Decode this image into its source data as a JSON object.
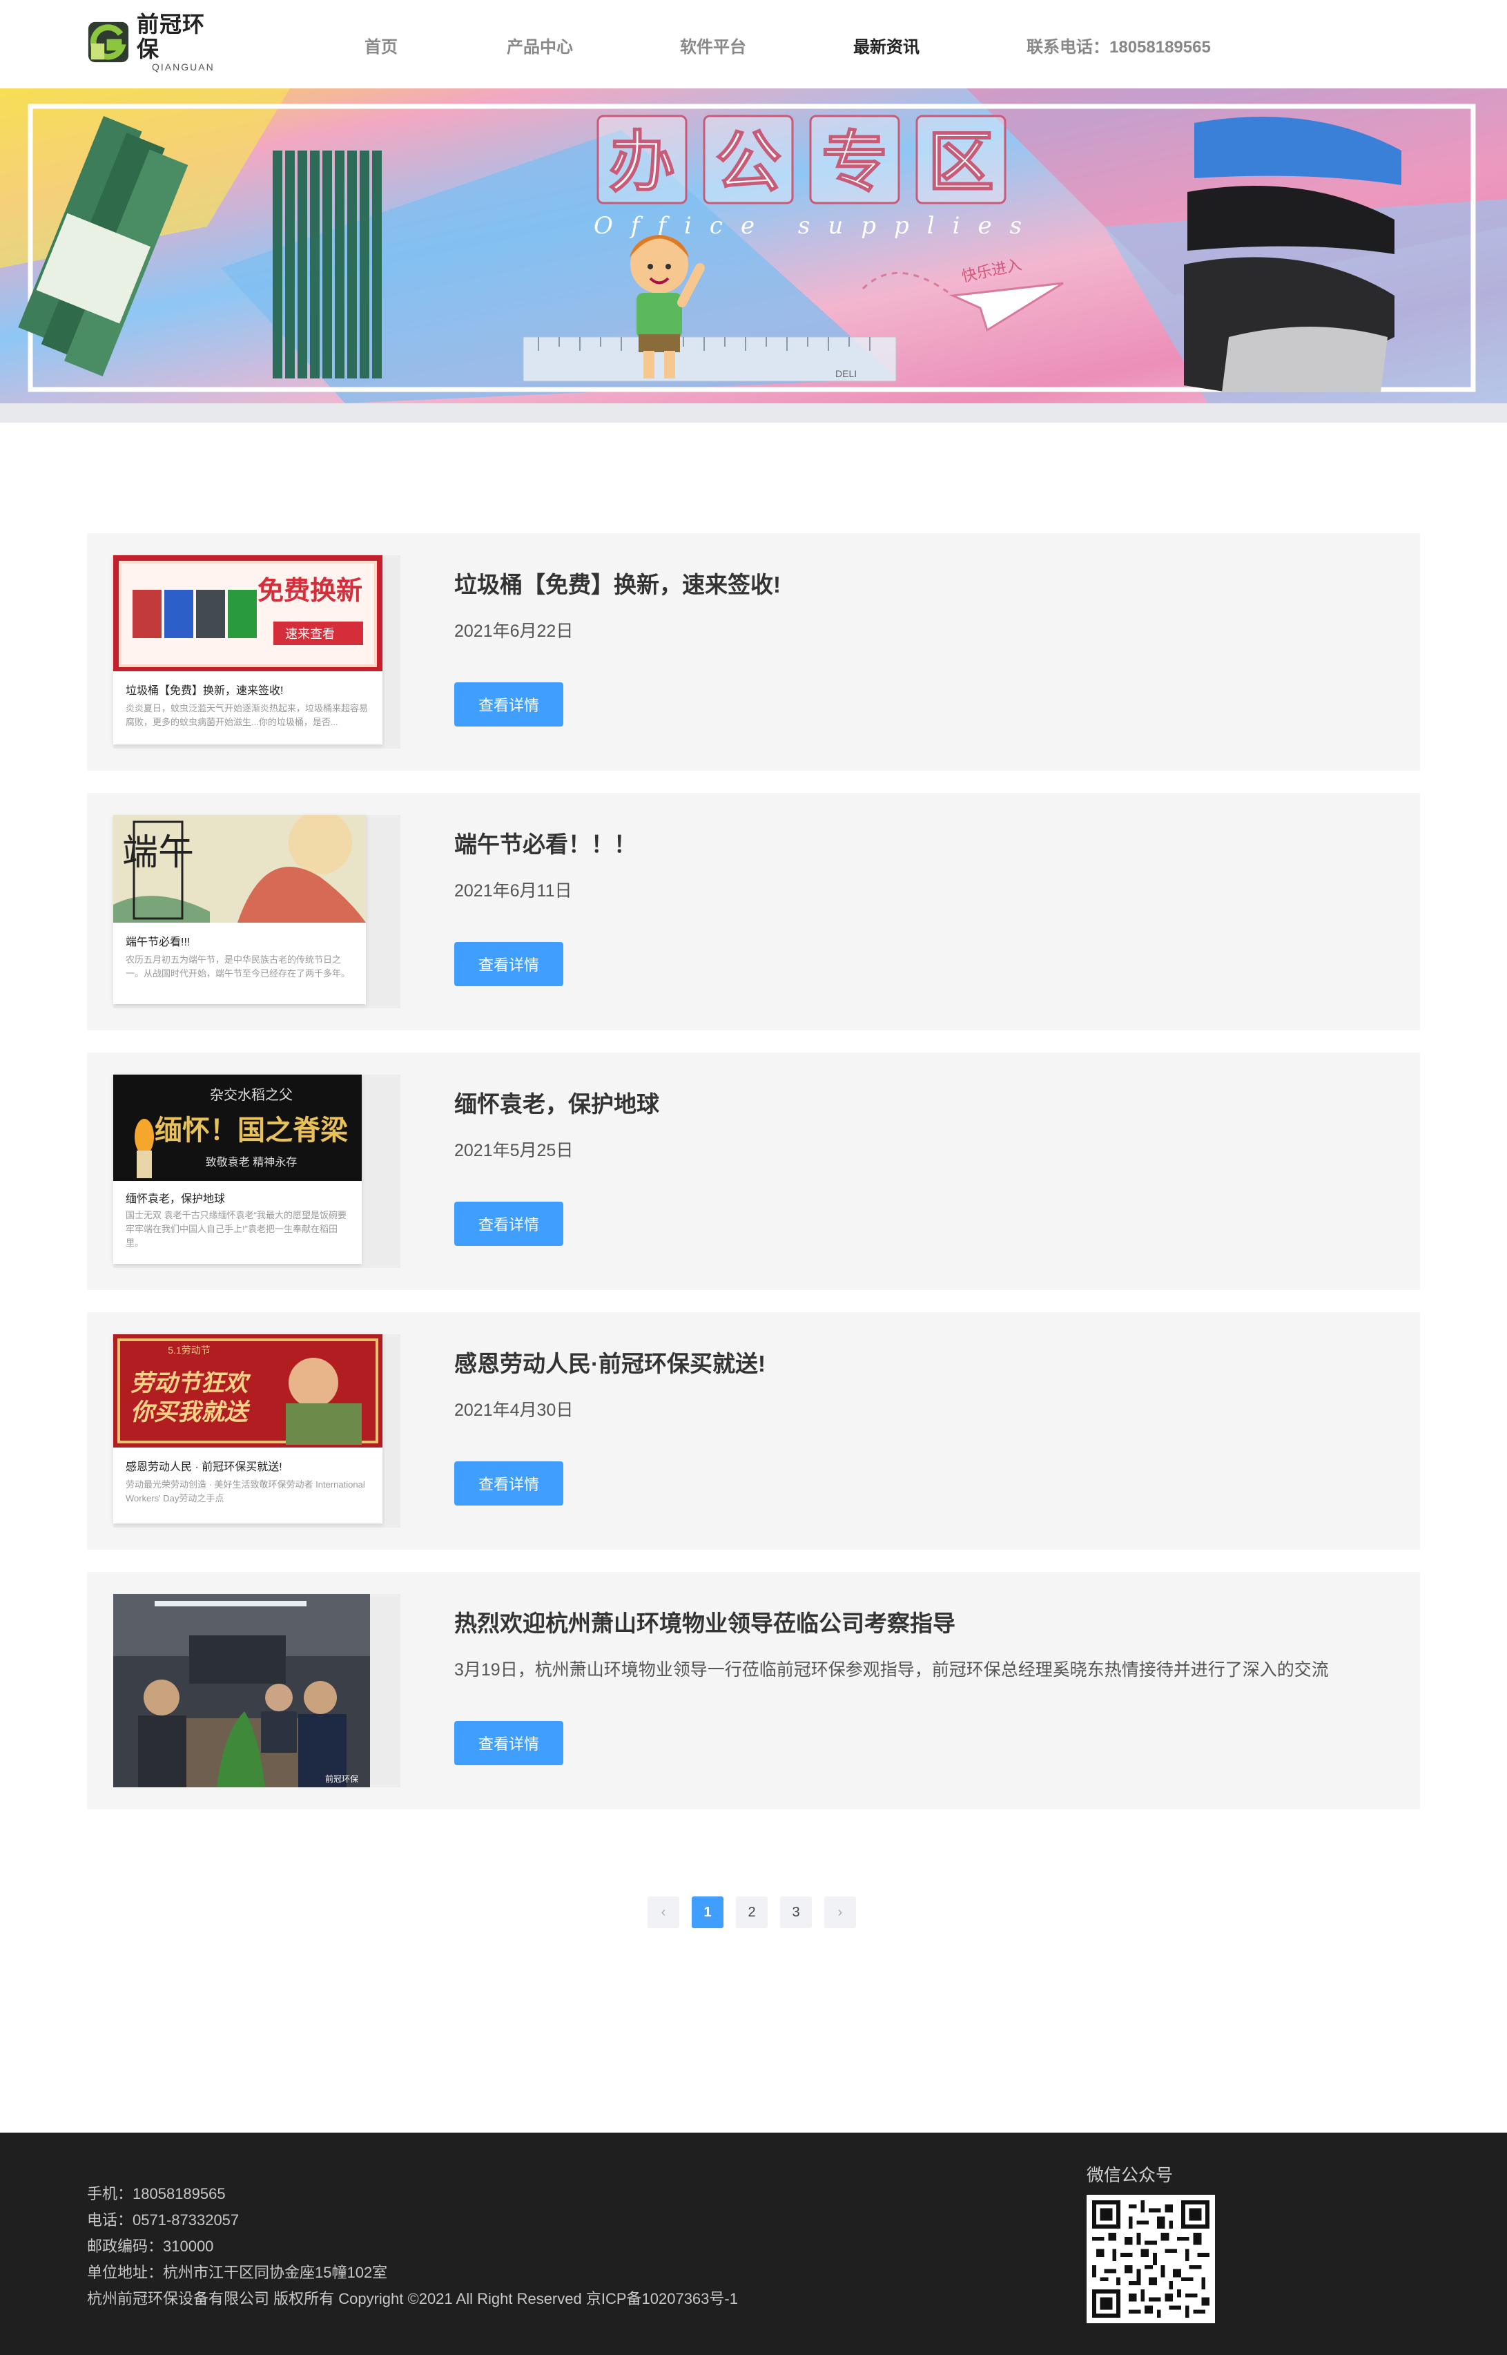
{
  "brand": {
    "name_cn": "前冠环保",
    "name_en": "QIANGUAN"
  },
  "nav": {
    "items": [
      {
        "label": "首页",
        "active": false
      },
      {
        "label": "产品中心",
        "active": false
      },
      {
        "label": "软件平台",
        "active": false
      },
      {
        "label": "最新资讯",
        "active": true
      }
    ],
    "phone": "联系电话：18058189565"
  },
  "banner": {
    "title_chars": [
      "办",
      "公",
      "专",
      "区"
    ],
    "subtitle": "Office  supplies",
    "arrow_text": "快乐进入",
    "ruler_brand": "DELI"
  },
  "news": [
    {
      "title": "垃圾桶【免费】换新，速来签收!",
      "date": "2021年6月22日",
      "button": "查看详情",
      "thumb_caption": "垃圾桶【免费】换新，速来签收!",
      "thumb_desc": "炎炎夏日，蚊虫泛滥天气开始逐渐炎热起来，垃圾桶来超容易腐败，更多的蚊虫病菌开始滋生...你的垃圾桶，是否...",
      "thumb_banner_text": "免费换新",
      "thumb_banner_sub": "速来查看"
    },
    {
      "title": "端午节必看！！！",
      "date": "2021年6月11日",
      "button": "查看详情",
      "thumb_caption": "端午节必看!!!",
      "thumb_desc": "农历五月初五为端午节，是中华民族古老的传统节日之一。从战国时代开始，端午节至今已经存在了两千多年。端午节，又称端阳节",
      "thumb_banner_text": "端午"
    },
    {
      "title": "缅怀袁老，保护地球",
      "date": "2021年5月25日",
      "button": "查看详情",
      "thumb_caption": "缅怀袁老，保护地球",
      "thumb_desc": "国士无双 袁老千古只缘缅怀袁老“我最大的愿望是饭碗要牢牢端在我们中国人自己手上!”袁老把一生奉献在稻田里。",
      "thumb_banner_top": "杂交水稻之父",
      "thumb_banner_text": "缅怀！国之脊梁",
      "thumb_banner_sub": "致敬袁老  精神永存"
    },
    {
      "title": "感恩劳动人民·前冠环保买就送!",
      "date": "2021年4月30日",
      "button": "查看详情",
      "thumb_caption": "感恩劳动人民 · 前冠环保买就送!",
      "thumb_desc": "劳动最光荣劳动创造 · 美好生活致敬环保劳动者 International Workers' Day劳动之手点",
      "thumb_banner_top": "5.1劳动节",
      "thumb_banner_text": "劳动节狂欢",
      "thumb_banner_sub": "你买我就送"
    },
    {
      "title": "热烈欢迎杭州萧山环境物业领导莅临公司考察指导",
      "date": "3月19日，杭州萧山环境物业领导一行莅临前冠环保参观指导，前冠环保总经理奚晓东热情接待并进行了深入的交流",
      "button": "查看详情",
      "thumb_watermark": "前冠环保"
    }
  ],
  "pagination": {
    "prev": "‹",
    "pages": [
      "1",
      "2",
      "3"
    ],
    "current": "1",
    "next": "›"
  },
  "footer": {
    "mobile": "手机：18058189565",
    "tel": "电话：0571-87332057",
    "postcode": "邮政编码：310000",
    "address": "单位地址：杭州市江干区同协金座15幢102室",
    "copyright": "杭州前冠环保设备有限公司 版权所有 Copyright ©2021 All Right Reserved 京ICP备10207363号-1",
    "wechat_title": "微信公众号"
  },
  "colors": {
    "accent": "#409eff",
    "footer_bg": "#1f1f20",
    "item_bg": "#f5f5f5",
    "logo_green": "#8cc63f"
  }
}
